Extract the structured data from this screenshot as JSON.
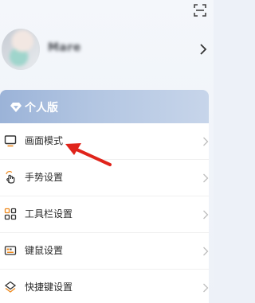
{
  "profile": {
    "username": "Mare"
  },
  "edition": {
    "label": "个人版"
  },
  "menu": {
    "items": [
      {
        "label": "画面模式",
        "icon": "monitor-icon"
      },
      {
        "label": "手势设置",
        "icon": "hand-gesture-icon"
      },
      {
        "label": "工具栏设置",
        "icon": "toolbar-grid-icon"
      },
      {
        "label": "键鼠设置",
        "icon": "keyboard-mouse-icon"
      },
      {
        "label": "快捷键设置",
        "icon": "shortcut-icon"
      }
    ]
  },
  "colors": {
    "accent_orange": "#ee8a1f",
    "edition_gradient_start": "#9bb3d8",
    "edition_gradient_end": "#c7d5ea",
    "annotation_arrow": "#e0241b"
  }
}
